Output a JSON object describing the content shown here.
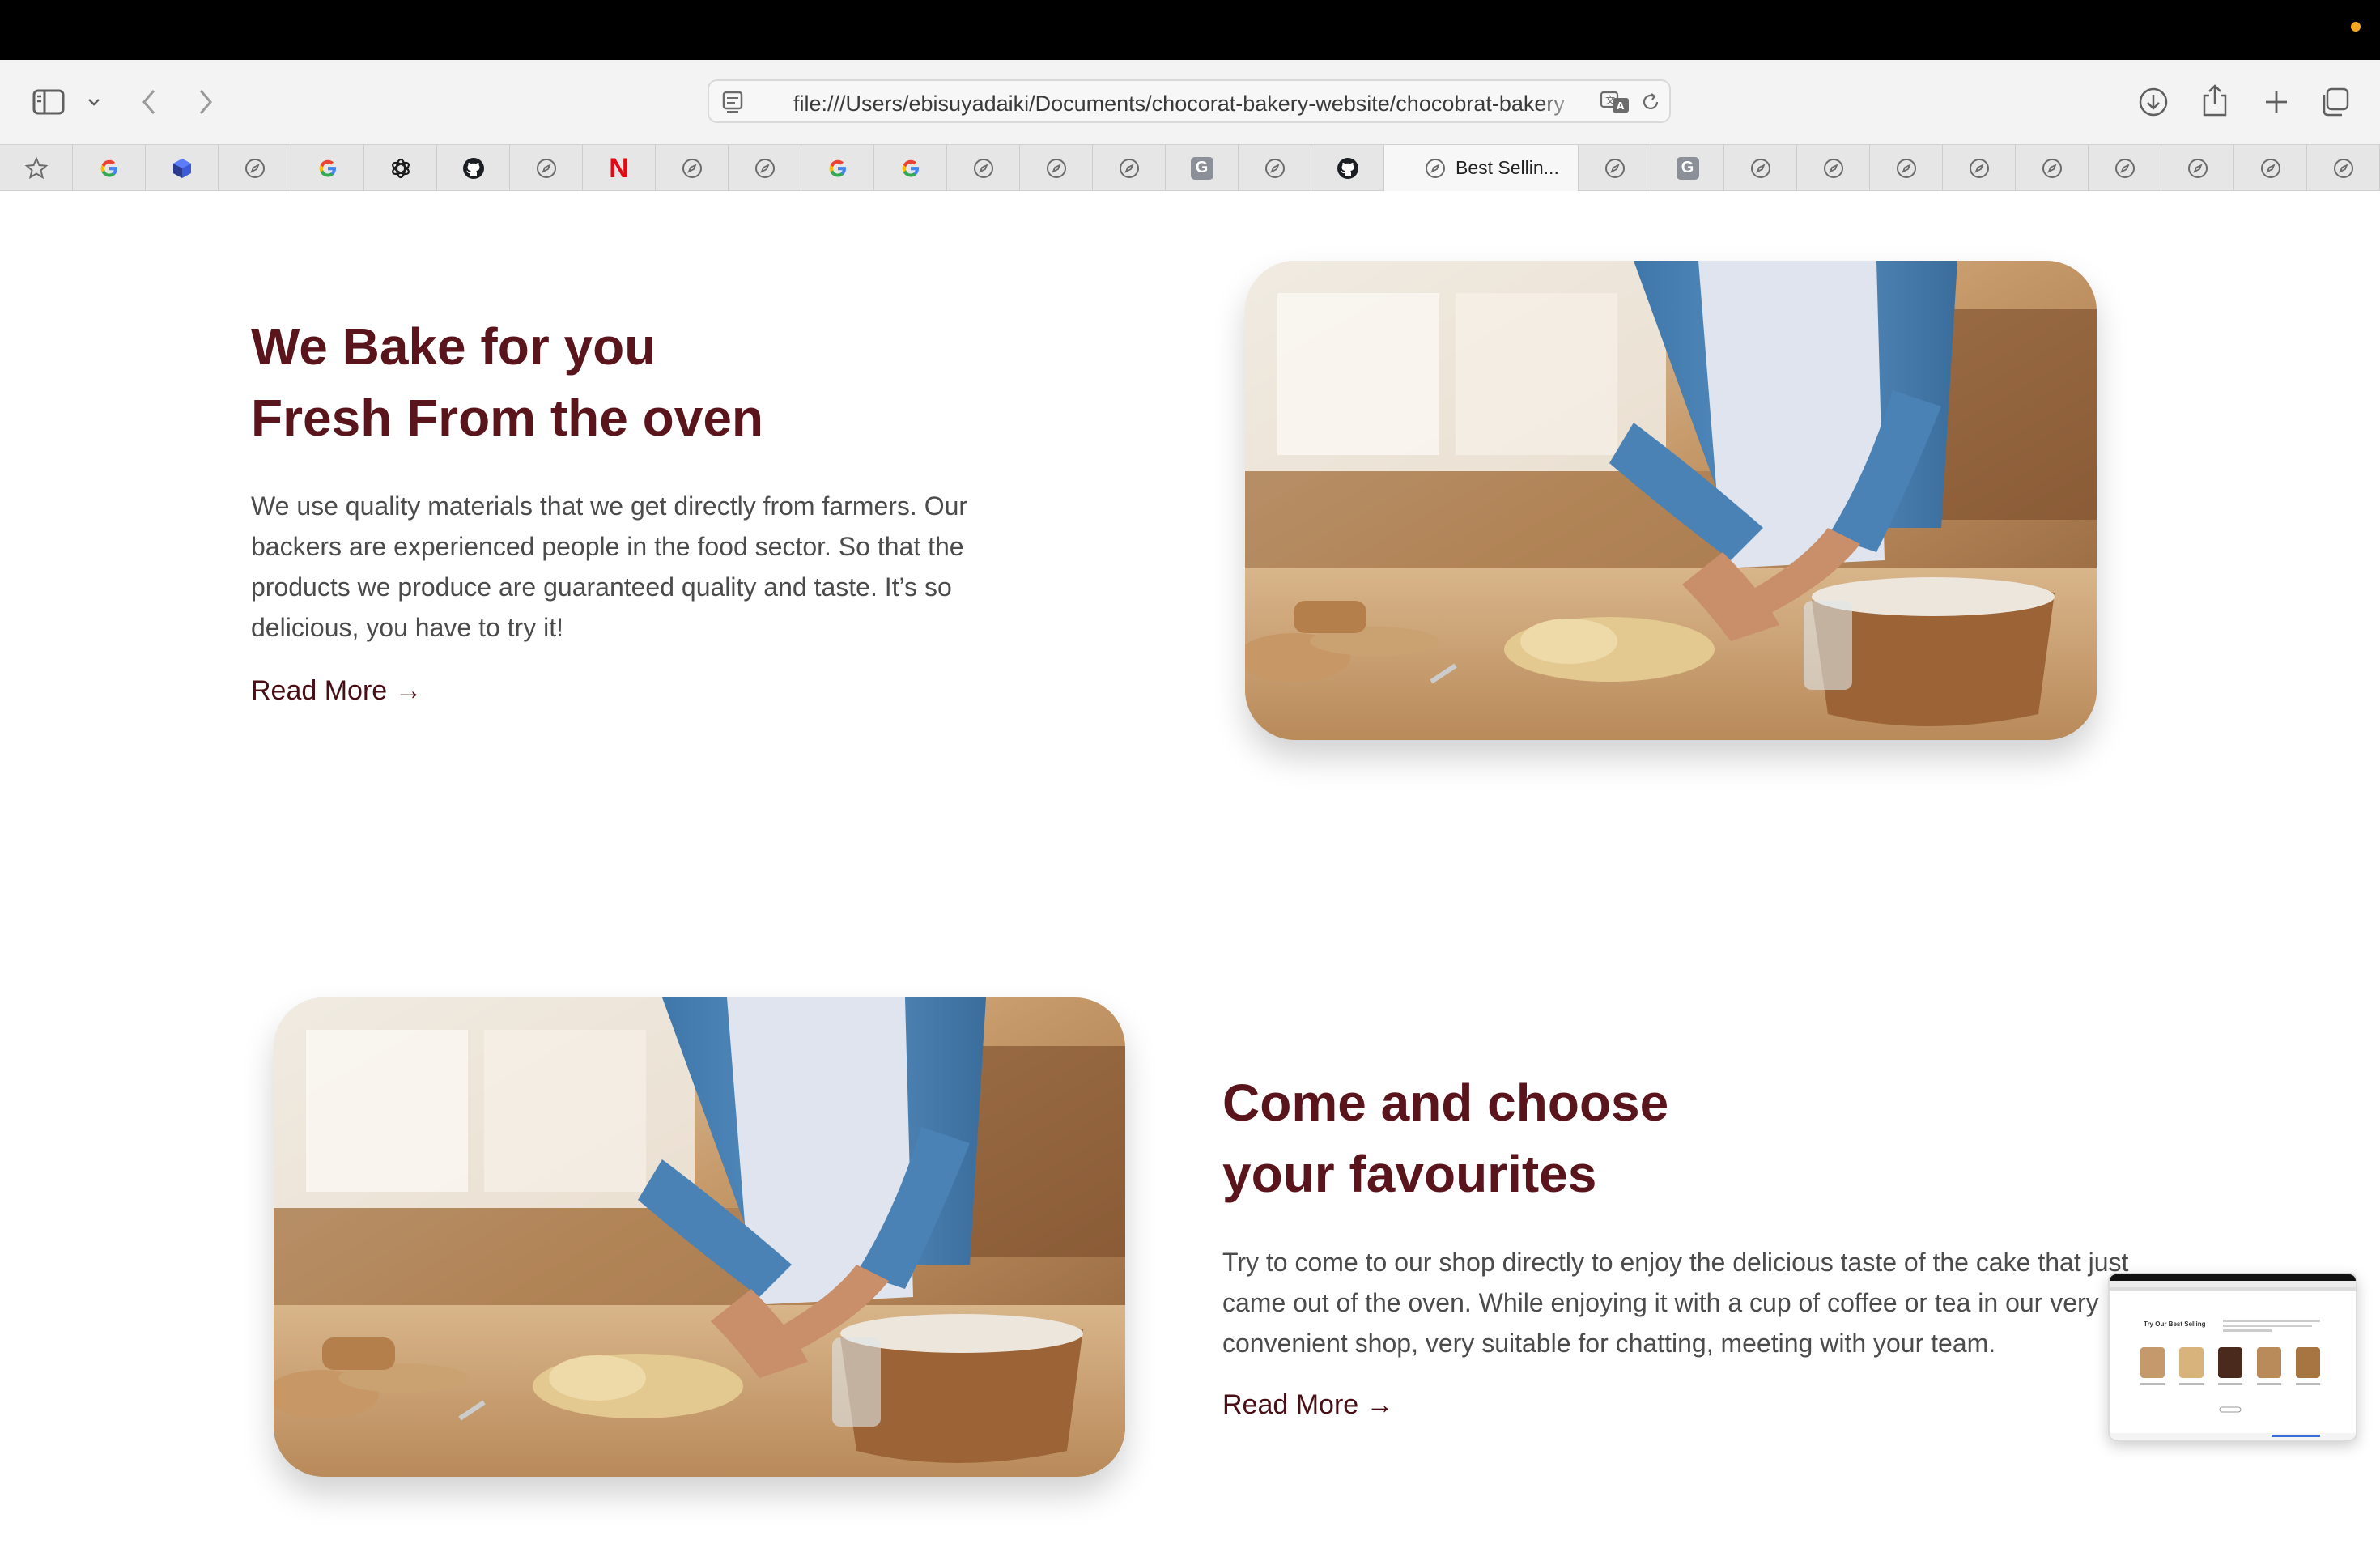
{
  "browser": {
    "url": "file:///Users/ebisuyadaiki/Documents/chocorat-bakery-website/chocobrat-bakery",
    "active_tab_title": "Best Sellin...",
    "tabs": [
      {
        "icon": "star-icon"
      },
      {
        "icon": "google-icon"
      },
      {
        "icon": "cube-icon"
      },
      {
        "icon": "compass-icon"
      },
      {
        "icon": "google-icon"
      },
      {
        "icon": "openai-icon"
      },
      {
        "icon": "github-icon"
      },
      {
        "icon": "compass-icon"
      },
      {
        "icon": "netflix-icon",
        "glyph": "N"
      },
      {
        "icon": "compass-icon"
      },
      {
        "icon": "compass-icon"
      },
      {
        "icon": "google-icon"
      },
      {
        "icon": "google-icon"
      },
      {
        "icon": "compass-icon"
      },
      {
        "icon": "compass-icon"
      },
      {
        "icon": "compass-icon"
      },
      {
        "icon": "grammarly-icon",
        "glyph": "G"
      },
      {
        "icon": "compass-icon"
      },
      {
        "icon": "github-icon"
      },
      {
        "icon": "compass-icon",
        "active": true
      },
      {
        "icon": "compass-icon"
      },
      {
        "icon": "grammarly-icon",
        "glyph": "G"
      },
      {
        "icon": "compass-icon"
      },
      {
        "icon": "compass-icon"
      },
      {
        "icon": "compass-icon"
      },
      {
        "icon": "compass-icon"
      },
      {
        "icon": "compass-icon"
      },
      {
        "icon": "compass-icon"
      },
      {
        "icon": "compass-icon"
      },
      {
        "icon": "compass-icon"
      },
      {
        "icon": "compass-icon"
      }
    ]
  },
  "section1": {
    "heading_line1": "We Bake for you",
    "heading_line2": "Fresh From the oven",
    "para_lines": [
      "We use quality materials that we get directly from farmers. Our",
      "backers are experienced people in the food sector. So that the",
      "products we produce are guaranteed quality and taste. It’s so",
      "delicious, you have to try it!"
    ],
    "read_more": "Read More →"
  },
  "section2": {
    "heading_line1": "Come and choose",
    "heading_line2": "your favourites",
    "para_lines": [
      "Try to come to our shop directly to enjoy the delicious taste of the cake that just",
      "came out of the oven. While enjoying it with a cup of coffee or tea in our very",
      "convenient shop, very suitable for chatting, meeting with your team."
    ],
    "read_more": "Read More →"
  },
  "thumbnail": {
    "title": "Try Our Best Selling"
  },
  "colors": {
    "heading": "#5a151c",
    "body_text": "#4b4b4b",
    "link": "#4a0f16"
  }
}
